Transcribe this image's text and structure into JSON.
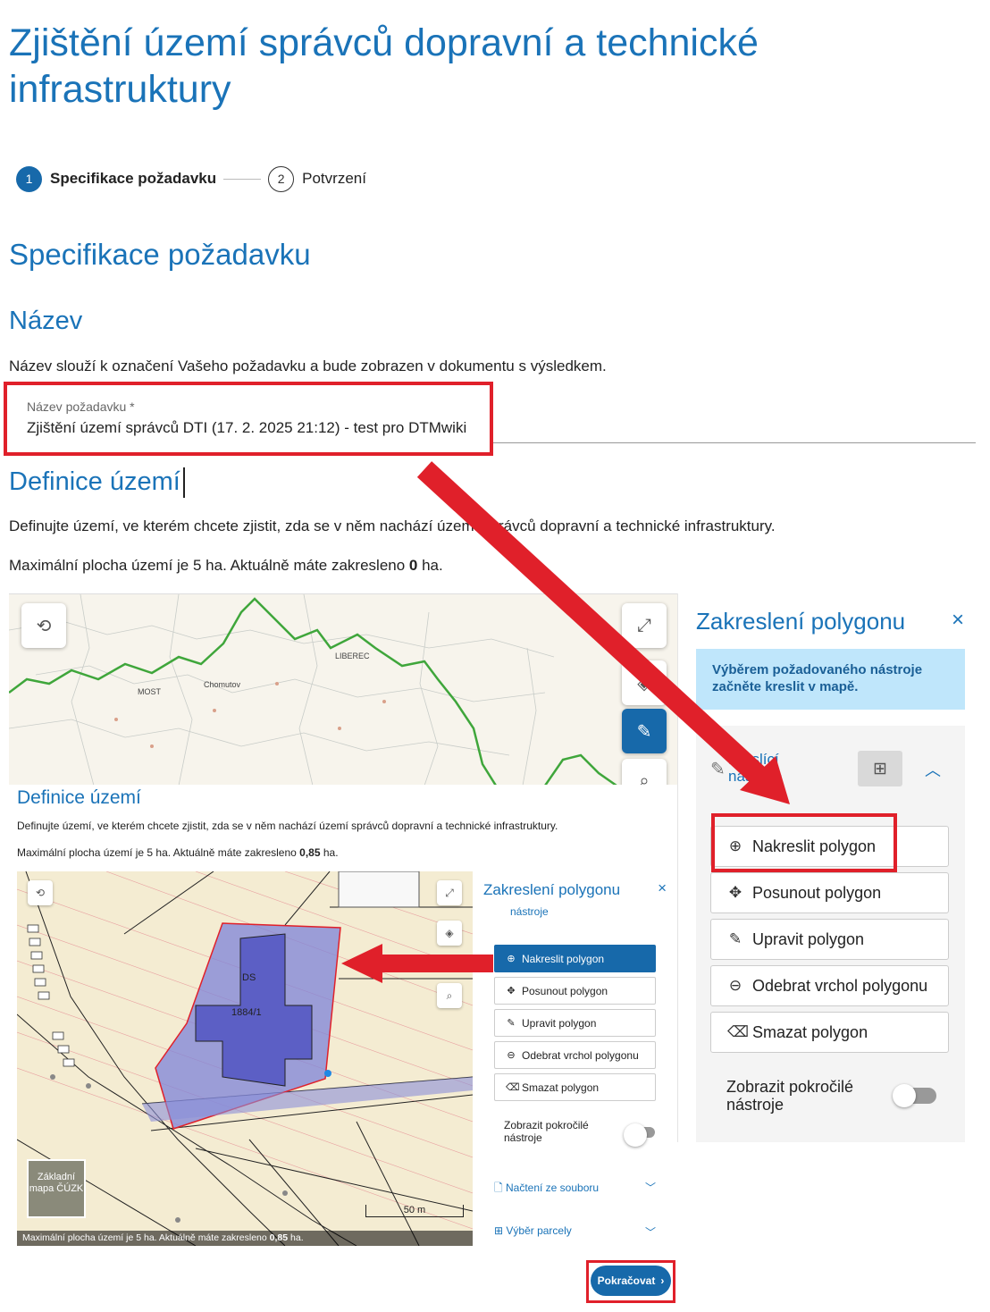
{
  "page": {
    "title": "Zjištění území správců dopravní a technické infrastruktury"
  },
  "stepper": {
    "step1": {
      "num": "1",
      "label": "Specifikace požadavku"
    },
    "step2": {
      "num": "2",
      "label": "Potvrzení"
    }
  },
  "section": {
    "heading": "Specifikace požadavku"
  },
  "nazev": {
    "heading": "Název",
    "description": "Název slouží k označení Vašeho požadavku a bude zobrazen v dokumentu s výsledkem.",
    "field_label": "Název požadavku *",
    "field_value": "Zjištění území správců DTI (17. 2. 2025 21:12) - test pro DTMwiki"
  },
  "definice": {
    "heading": "Definice území",
    "description": "Definujte území, ve kterém chcete zjistit, zda se v něm nachází území správců dopravní a technické infrastruktury.",
    "area_prefix": "Maximální plocha území je 5 ha. Aktuálně máte zakresleno ",
    "area_value": "0",
    "area_suffix": " ha."
  },
  "map": {
    "labels": [
      "MOST",
      "LIBEREC",
      "Chomutov"
    ]
  },
  "panel": {
    "title": "Zakreslení polygonu",
    "close": "×",
    "info": "Výběrem požadovaného nástroje začněte kreslit v mapě.",
    "tools_label": "Kreslící nástroje",
    "tools": [
      {
        "label": "Nakreslit polygon",
        "icon": "draw-polygon-icon"
      },
      {
        "label": "Posunout polygon",
        "icon": "move-polygon-icon"
      },
      {
        "label": "Upravit polygon",
        "icon": "edit-polygon-icon"
      },
      {
        "label": "Odebrat vrchol polygonu",
        "icon": "remove-vertex-icon"
      },
      {
        "label": "Smazat polygon",
        "icon": "delete-polygon-icon"
      }
    ],
    "advanced_label": "Zobrazit pokročilé nástroje"
  },
  "embed": {
    "heading": "Definice území",
    "description": "Definujte území, ve kterém chcete zjistit, zda se v něm nachází území správců dopravní a technické infrastruktury.",
    "area_prefix": "Maximální plocha území je 5 ha. Aktuálně máte zakresleno ",
    "area_value": "0,85",
    "area_suffix": " ha.",
    "map_footer_prefix": "Maximální plocha území je 5 ha. Aktuálně máte zakresleno ",
    "map_footer_value": "0,85",
    "map_footer_suffix": " ha.",
    "base_map": "Základní mapa ČÚZK",
    "scale": "50 m",
    "parcel_label": "DS",
    "parcel_number": "1884/1",
    "panel_title": "Zakreslení polygonu",
    "panel_tools_label": "nástroje",
    "tools": [
      "Nakreslit polygon",
      "Posunout polygon",
      "Upravit polygon",
      "Odebrat vrchol polygonu",
      "Smazat polygon"
    ],
    "advanced_label": "Zobrazit pokročilé nástroje",
    "file_load": "Načtení ze souboru",
    "parcel_select": "Výběr parcely"
  },
  "continue_button": "Pokračovat",
  "colors": {
    "accent": "#1a73b8",
    "highlight": "#e0202a",
    "info_bg": "#bfe6fb",
    "polygon_fill": "#7d83d8"
  }
}
